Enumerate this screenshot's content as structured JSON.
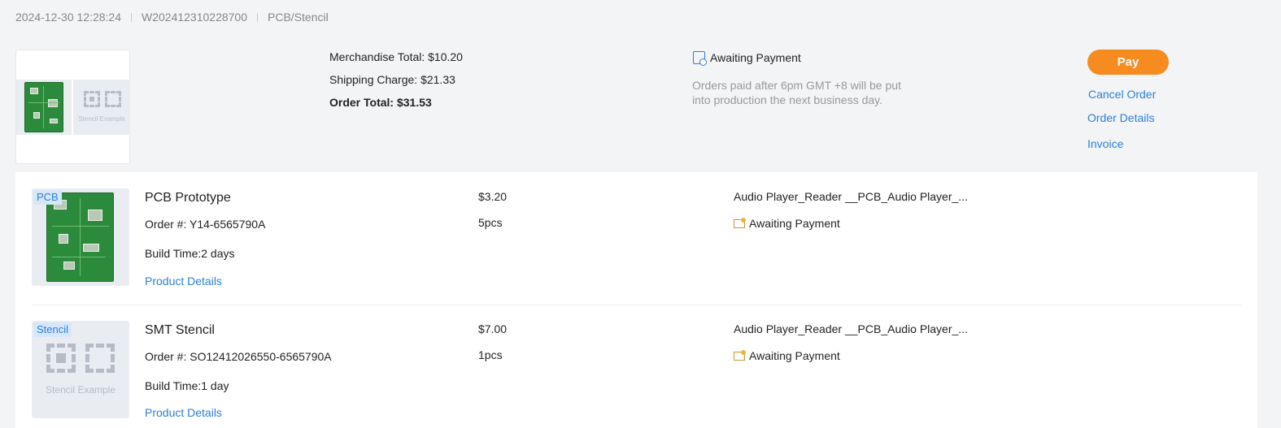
{
  "order": {
    "datetime": "2024-12-30 12:28:24",
    "number": "W202412310228700",
    "category": "PCB/Stencil"
  },
  "thumbnails": {
    "stencil_caption": "Stencil Example"
  },
  "totals": {
    "merchandise": "Merchandise Total: $10.20",
    "shipping": "Shipping Charge: $21.33",
    "order_total": "Order Total: $31.53"
  },
  "status": {
    "label": "Awaiting Payment",
    "icon": "payment-search-icon",
    "note": "Orders paid after 6pm GMT +8 will be put into production the next business day."
  },
  "actions": {
    "pay": "Pay",
    "cancel": "Cancel Order",
    "details": "Order Details",
    "invoice": "Invoice"
  },
  "colors": {
    "accent_orange": "#f68b1f",
    "link_blue": "#2b7fd6",
    "pcb_green": "#2c8a3c"
  },
  "items": [
    {
      "tag": "PCB",
      "title": "PCB Prototype",
      "order_no": "Order #: Y14-6565790A",
      "build_time": "Build Time:2 days",
      "details_link": "Product Details",
      "price": "$3.20",
      "qty": "5pcs",
      "file_name": "Audio Player_Reader __PCB_Audio Player_...",
      "status": "Awaiting Payment"
    },
    {
      "tag": "Stencil",
      "title": "SMT Stencil",
      "order_no": "Order #: SO12412026550-6565790A",
      "build_time": "Build Time:1 day",
      "details_link": "Product Details",
      "price": "$7.00",
      "qty": "1pcs",
      "file_name": "Audio Player_Reader __PCB_Audio Player_...",
      "status": "Awaiting Payment",
      "thumb_caption": "Stencil Example"
    }
  ]
}
